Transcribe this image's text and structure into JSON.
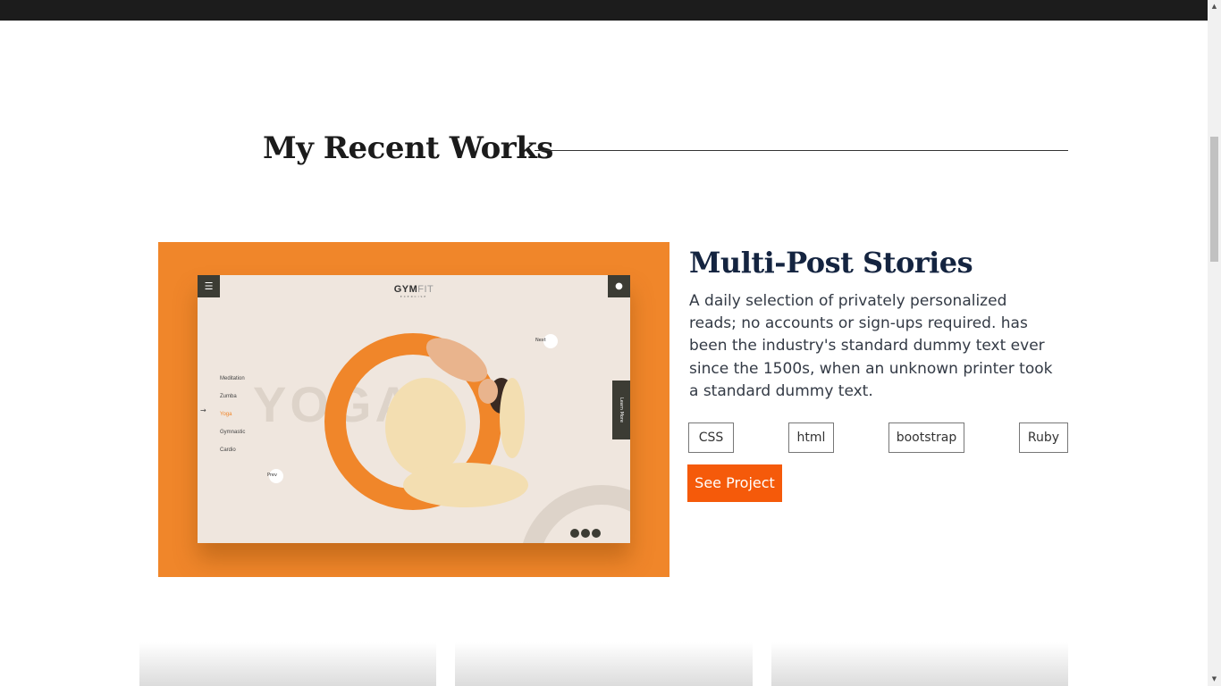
{
  "section": {
    "title": "My Recent Works"
  },
  "project": {
    "title": "Multi-Post Stories",
    "description": "A daily selection of privately personalized reads; no accounts or sign-ups required. has been the industry's standard dummy text ever since the 1500s, when an unknown printer took a standard dummy text.",
    "tags": [
      "CSS",
      "html",
      "bootstrap",
      "Ruby"
    ],
    "button_label": "See Project",
    "image": {
      "logo_main": "GYM",
      "logo_accent": "FIT",
      "logo_sub": "EXERCISE",
      "hero_word": "YOGA",
      "menu_items": [
        "Meditation",
        "Zumba",
        "Yoga",
        "Gymnastic",
        "Cardio"
      ],
      "active_item": "Yoga",
      "next_label": "Next",
      "prev_label": "Prev",
      "side_tab": "Learn More",
      "accent_color": "#f0862a"
    }
  },
  "colors": {
    "button": "#f55a0a",
    "title": "#142440",
    "topbar": "#1c1c1c"
  }
}
